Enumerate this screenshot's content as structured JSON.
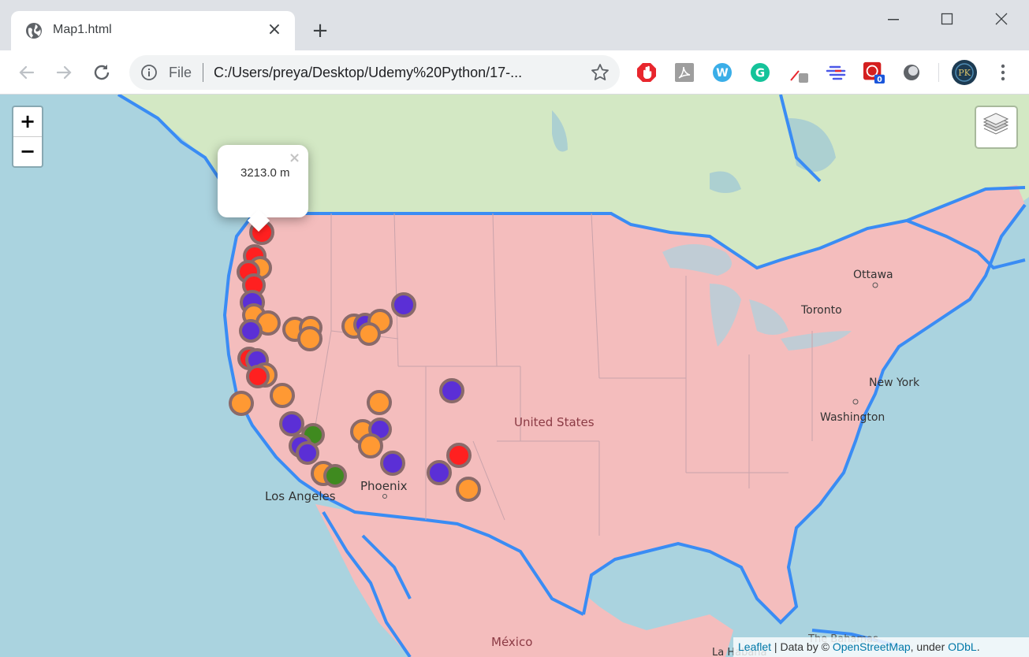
{
  "browser": {
    "tab_title": "Map1.html",
    "new_tab_label": "+",
    "close_tab_label": "×",
    "window_controls": {
      "minimize": "—",
      "maximize": "☐",
      "close": "✕"
    },
    "omnibox": {
      "scheme_label": "File",
      "url": "C:/Users/preya/Desktop/Udemy%20Python/17-..."
    },
    "extensions": [
      {
        "name": "adblock-icon",
        "color": "#e8262d"
      },
      {
        "name": "pdf-icon",
        "color": "#9e9e9e"
      },
      {
        "name": "w-extension-icon",
        "color": "#3aaee8"
      },
      {
        "name": "grammarly-icon",
        "color": "#15c39a"
      },
      {
        "name": "eyedropper-icon",
        "color": "#9e9e9e"
      },
      {
        "name": "lines-extension-icon",
        "color": "#4a57e8"
      },
      {
        "name": "badge-extension-icon",
        "color": "#d41f1f",
        "badge": "0"
      },
      {
        "name": "circle-extension-icon",
        "color": "#5f6368"
      }
    ],
    "profile_initials": "PK"
  },
  "map": {
    "zoom_in_label": "+",
    "zoom_out_label": "−",
    "popup_text": "3213.0 m",
    "popup_close": "×",
    "labels": {
      "ottawa": "Ottawa",
      "toronto": "Toronto",
      "new_york": "New York",
      "washington": "Washington",
      "united_states": "United States",
      "phoenix": "Phoenix",
      "los_angeles": "Los Angeles",
      "mexico": "México",
      "bahamas": "The Bahamas",
      "la_habana": "La Habana"
    },
    "attribution": {
      "leaflet": "Leaflet",
      "text1": " | Data by © ",
      "osm": "OpenStreetMap",
      "text2": ", under ",
      "odbl": "ODbL",
      "text3": "."
    },
    "colors": {
      "water": "#aad3df",
      "land": "#d3e8c4",
      "us_fill": "#f4bdbd",
      "border": "#3a8cf4",
      "marker_red": "#ff2020",
      "marker_orange": "#ff9933",
      "marker_purple": "#5b2fd6",
      "marker_green": "#3f8a1f"
    }
  }
}
